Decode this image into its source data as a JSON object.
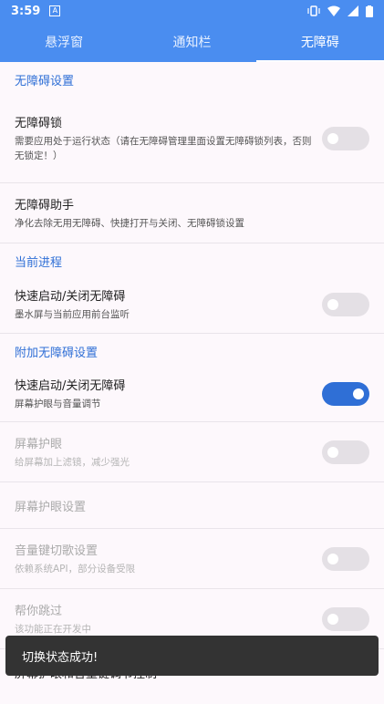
{
  "status": {
    "time": "3:59",
    "app_icon": "A"
  },
  "tabs": [
    "悬浮窗",
    "通知栏",
    "无障碍"
  ],
  "sections": [
    {
      "header": "无障碍设置",
      "items": [
        {
          "title": "无障碍锁",
          "subtitle": "需要应用处于运行状态（请在无障碍管理里面设置无障碍锁列表，否则无锁定！）",
          "toggle": "off"
        },
        {
          "title": "无障碍助手",
          "subtitle": "净化去除无用无障碍、快捷打开与关闭、无障碍锁设置"
        }
      ]
    },
    {
      "header": "当前进程",
      "items": [
        {
          "title": "快速启动/关闭无障碍",
          "subtitle": "墨水屏与当前应用前台监听",
          "toggle": "off"
        }
      ]
    },
    {
      "header": "附加无障碍设置",
      "items": [
        {
          "title": "快速启动/关闭无障碍",
          "subtitle": "屏幕护眼与音量调节",
          "toggle": "on"
        },
        {
          "title": "屏幕护眼",
          "subtitle": "给屏幕加上滤镜，减少强光",
          "toggle": "off",
          "disabled": true
        },
        {
          "title": "屏幕护眼设置",
          "disabled": true
        },
        {
          "title": "音量键切歌设置",
          "subtitle": "依赖系统API，部分设备受限",
          "toggle": "off",
          "disabled": true
        },
        {
          "title": "帮你跳过",
          "subtitle": "该功能正在开发中",
          "toggle": "off",
          "disabled": true
        },
        {
          "title": "屏幕护眼和音量键调节控制"
        }
      ]
    }
  ],
  "toast": "切换状态成功!",
  "colors": {
    "primary": "#4a8df0",
    "accent": "#2f6fd6",
    "toast_bg": "#333333"
  }
}
